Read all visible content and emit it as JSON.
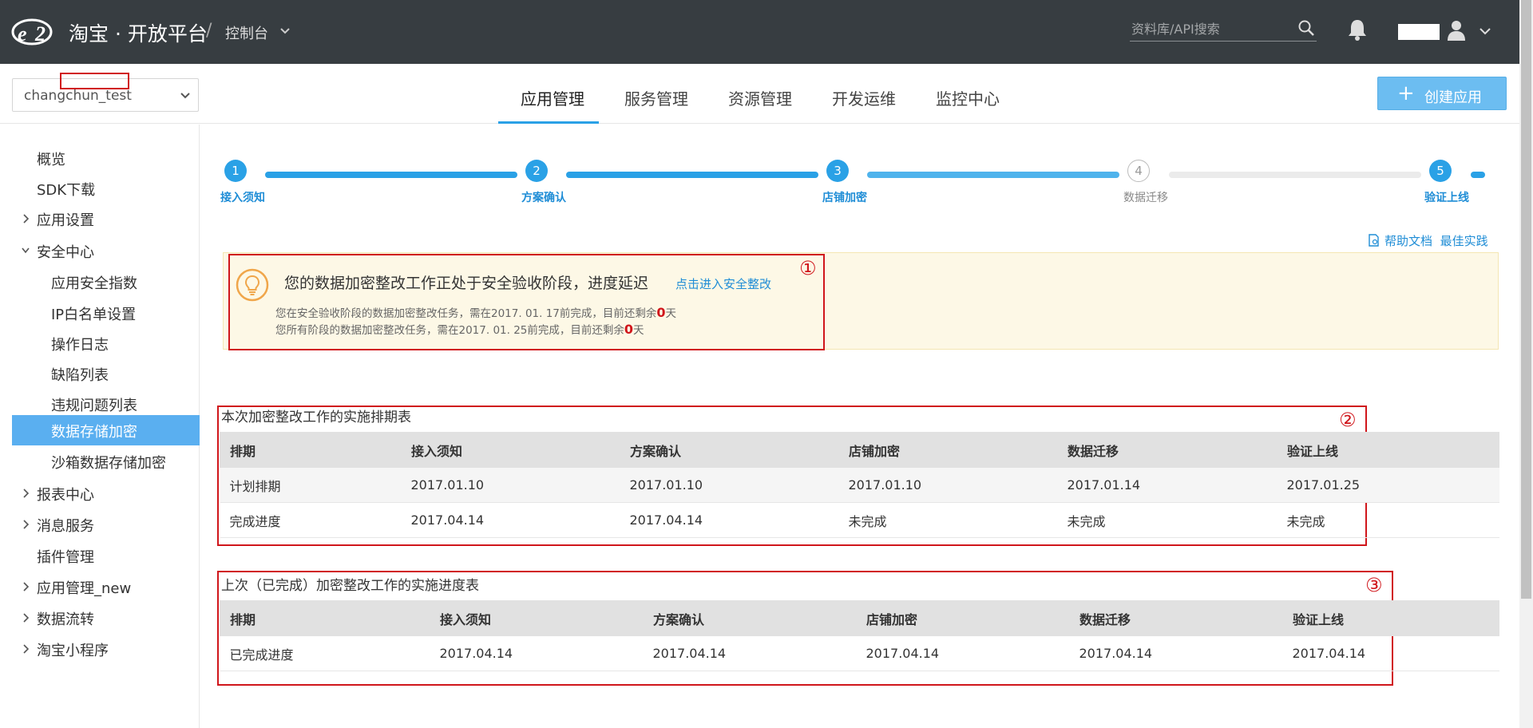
{
  "topbar": {
    "brand": "淘宝 · 开放平台",
    "separator": "/",
    "console_label": "控制台",
    "search_placeholder": "资料库/API搜索"
  },
  "app_selector": {
    "value_prefix": "chang",
    "value_highlight": "chun_test"
  },
  "nav": {
    "tabs": [
      {
        "label": "应用管理",
        "active": true
      },
      {
        "label": "服务管理"
      },
      {
        "label": "资源管理"
      },
      {
        "label": "开发运维"
      },
      {
        "label": "监控中心"
      }
    ],
    "create_button": "创建应用",
    "create_icon": "+"
  },
  "sidebar": {
    "items": [
      {
        "label": "概览"
      },
      {
        "label": "SDK下载"
      },
      {
        "label": "应用设置",
        "chevron": "right"
      },
      {
        "label": "安全中心",
        "chevron": "down"
      },
      {
        "label": "应用安全指数",
        "child": true
      },
      {
        "label": "IP白名单设置",
        "child": true
      },
      {
        "label": "操作日志",
        "child": true
      },
      {
        "label": "缺陷列表",
        "child": true
      },
      {
        "label": "违规问题列表",
        "child": true
      },
      {
        "label": "数据存储加密",
        "child": true,
        "active": true
      },
      {
        "label": "沙箱数据存储加密",
        "child": true
      },
      {
        "label": "报表中心",
        "chevron": "right"
      },
      {
        "label": "消息服务",
        "chevron": "right"
      },
      {
        "label": "插件管理"
      },
      {
        "label": "应用管理_new",
        "chevron": "right"
      },
      {
        "label": "数据流转",
        "chevron": "right"
      },
      {
        "label": "淘宝小程序",
        "chevron": "right"
      }
    ]
  },
  "steps": [
    {
      "num": "1",
      "label": "接入须知",
      "done": true
    },
    {
      "num": "2",
      "label": "方案确认",
      "done": true
    },
    {
      "num": "3",
      "label": "店铺加密",
      "done": true
    },
    {
      "num": "4",
      "label": "数据迁移",
      "done": false
    },
    {
      "num": "5",
      "label": "验证上线",
      "done": true
    }
  ],
  "help": {
    "docs": "帮助文档",
    "best": "最佳实践"
  },
  "notice": {
    "title": "您的数据加密整改工作正处于安全验收阶段，进度延迟",
    "link": "点击进入安全整改",
    "line1_prefix": "您在安全验收阶段的数据加密整改任务，需在2017. 01. 17前完成，目前还剩余",
    "line1_days": "0",
    "line1_suffix": "天",
    "line2_prefix": "您所有阶段的数据加密整改任务，需在2017. 01. 25前完成，目前还剩余",
    "line2_days": "0",
    "line2_suffix": "天"
  },
  "markers": {
    "one": "①",
    "two": "②",
    "three": "③"
  },
  "table1": {
    "title": "本次加密整改工作的实施排期表",
    "headers": [
      "排期",
      "接入须知",
      "方案确认",
      "店铺加密",
      "数据迁移",
      "验证上线"
    ],
    "rows": [
      [
        "计划排期",
        "2017.01.10",
        "2017.01.10",
        "2017.01.10",
        "2017.01.14",
        "2017.01.25"
      ],
      [
        "完成进度",
        "2017.04.14",
        "2017.04.14",
        "未完成",
        "未完成",
        "未完成"
      ]
    ]
  },
  "table2": {
    "title": "上次（已完成）加密整改工作的实施进度表",
    "headers": [
      "排期",
      "接入须知",
      "方案确认",
      "店铺加密",
      "数据迁移",
      "验证上线"
    ],
    "rows": [
      [
        "已完成进度",
        "2017.04.14",
        "2017.04.14",
        "2017.04.14",
        "2017.04.14",
        "2017.04.14"
      ]
    ]
  },
  "colors": {
    "topbar": "#373d41",
    "accent": "#2aa1e6",
    "highlight_red": "#d0161b",
    "notice_bg": "#fdf8e6"
  }
}
